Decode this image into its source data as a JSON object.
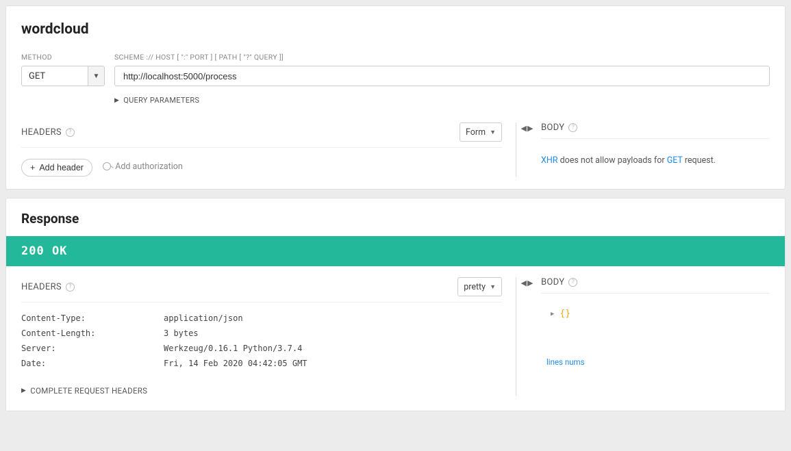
{
  "request": {
    "title": "wordcloud",
    "method_label": "METHOD",
    "method_value": "GET",
    "url_label": "SCHEME :// HOST [ \":\" PORT ] [ PATH [ \"?\" QUERY ]]",
    "url_value": "http://localhost:5000/process",
    "query_params_label": "QUERY PARAMETERS",
    "headers_title": "HEADERS",
    "form_selector": "Form",
    "add_header_label": "Add header",
    "add_auth_label": "Add authorization",
    "body_title": "BODY",
    "body_msg_prefix": "XHR",
    "body_msg_mid": " does not allow payloads for ",
    "body_msg_method": "GET",
    "body_msg_suffix": " request."
  },
  "response": {
    "title": "Response",
    "status": "200 OK",
    "headers_title": "HEADERS",
    "view_selector": "pretty",
    "headers": [
      {
        "key": "Content-Type:",
        "value": "application/json"
      },
      {
        "key": "Content-Length:",
        "value": "3 bytes"
      },
      {
        "key": "Server:",
        "value": "Werkzeug/0.16.1 Python/3.7.4"
      },
      {
        "key": "Date:",
        "value": "Fri, 14 Feb 2020 04:42:05 GMT"
      }
    ],
    "complete_headers_label": "COMPLETE REQUEST HEADERS",
    "body_title": "BODY",
    "json_preview": "{}",
    "lines_nums_label": "lines nums"
  }
}
